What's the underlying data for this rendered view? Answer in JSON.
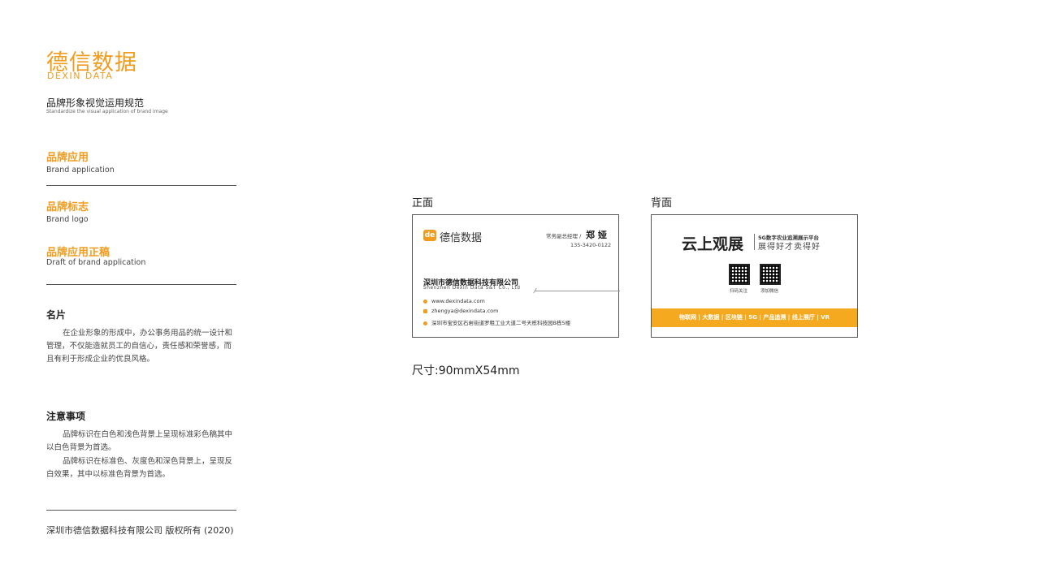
{
  "logo": {
    "cn": "德信数据",
    "en": "DEXIN DATA"
  },
  "header": {
    "title_cn": "品牌形象视觉运用规范",
    "title_en": "Standardize the visual application of brand image"
  },
  "sections": [
    {
      "cn": "品牌应用",
      "en": "Brand application"
    },
    {
      "cn": "品牌标志",
      "en": "Brand logo"
    },
    {
      "cn": "品牌应用正稿",
      "en": "Draft of brand application"
    }
  ],
  "card_section": {
    "title": "名片",
    "body": "在企业形象的形成中，办公事务用品的统一设计和管理，不仅能造就员工的自信心，责任感和荣誉感，而且有利于形成企业的优良风格。"
  },
  "notes": {
    "title": "注意事项",
    "p1": "品牌标识在白色和浅色背景上呈现标准彩色稿其中以白色背景为首选。",
    "p2": "品牌标识在标准色、灰度色和深色背景上，呈现反白效果，其中以标准色背景为首选。"
  },
  "footer": "深圳市德信数据科技有限公司   版权所有 (2020)",
  "labels": {
    "front": "正面",
    "back": "背面",
    "size": "尺寸:90mmX54mm"
  },
  "front": {
    "badge": "de",
    "brand": "德信数据",
    "role": "常务副总经理 /",
    "name": "郑  娅",
    "phone": "135-3420-0122",
    "company": "深圳市德信数据科技有限公司",
    "company_en": "Shenzhen Dexin Data S&T Co., Ltd",
    "web": "www.dexindata.com",
    "email": "zhengya@dexindata.com",
    "address": "深圳市宝安区石岩街道罗租工业大道二号天栋科技园B栋5楼"
  },
  "back": {
    "big": "云上观展",
    "small": "5G数字农业追溯展示平台",
    "slogan": "展得好才卖得好",
    "qr1_caption": "扫码关注",
    "qr2_caption": "添加微信",
    "bar": "物联网 | 大数据 | 区块链 | 5G | 产品追溯 | 线上展厅 | VR"
  },
  "colors": {
    "accent": "#f29c1f",
    "bar": "#f5a91f"
  }
}
